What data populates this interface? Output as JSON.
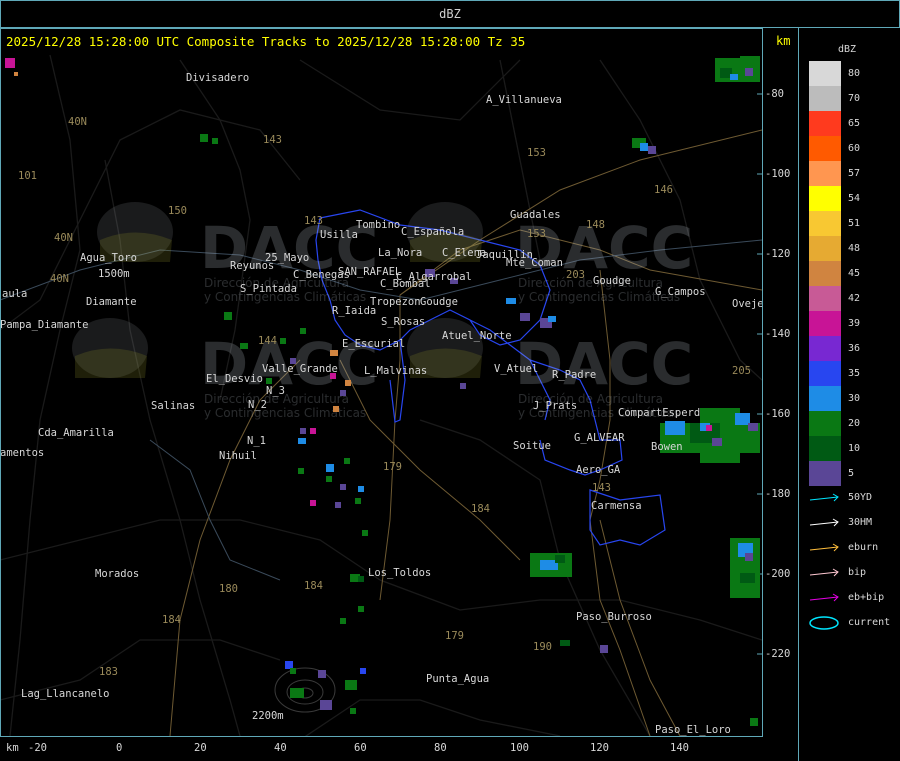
{
  "window": {
    "title": "dBZ"
  },
  "header": {
    "headline": "2025/12/28 15:28:00 UTC Composite Tracks to 2025/12/28 15:28:00 Tz 35",
    "unit_right": "km",
    "unit_bottom_left": "km"
  },
  "axes": {
    "x_ticks": [
      "-20",
      "0",
      "20",
      "40",
      "60",
      "80",
      "100",
      "120",
      "140"
    ],
    "y_ticks": [
      "-80",
      "-100",
      "-120",
      "-140",
      "-160",
      "-180",
      "-200",
      "-220"
    ]
  },
  "legend": {
    "title": "dBZ",
    "levels": [
      {
        "label": "80",
        "color": "#d8d8d8"
      },
      {
        "label": "70",
        "color": "#bcbcbc"
      },
      {
        "label": "65",
        "color": "#ff3a1e"
      },
      {
        "label": "60",
        "color": "#ff5a00"
      },
      {
        "label": "57",
        "color": "#ff9650"
      },
      {
        "label": "54",
        "color": "#ffff00"
      },
      {
        "label": "51",
        "color": "#f8c832"
      },
      {
        "label": "48",
        "color": "#e6aa32"
      },
      {
        "label": "45",
        "color": "#d08440"
      },
      {
        "label": "42",
        "color": "#c85a96"
      },
      {
        "label": "39",
        "color": "#c81496"
      },
      {
        "label": "36",
        "color": "#7828d2"
      },
      {
        "label": "35",
        "color": "#2846f0"
      },
      {
        "label": "30",
        "color": "#1e8ce6"
      },
      {
        "label": "20",
        "color": "#0a7814"
      },
      {
        "label": "10",
        "color": "#005a14"
      },
      {
        "label": "5",
        "color": "#5a4696"
      }
    ],
    "tracks": [
      {
        "label": "50YD",
        "color": "#00e6ff"
      },
      {
        "label": "30HM",
        "color": "#ffffff"
      },
      {
        "label": "eburn",
        "color": "#ffbe3c"
      },
      {
        "label": "bip",
        "color": "#ffc8d2"
      },
      {
        "label": "eb+bip",
        "color": "#e600e6"
      },
      {
        "label": "current",
        "color": "#00e6ff"
      }
    ]
  },
  "watermark": {
    "logo_text": "DACC",
    "subtitle_1": "Dirección de Agricultura",
    "subtitle_2": "y Contingencias Climáticas"
  },
  "places": [
    {
      "name": "Divisadero"
    },
    {
      "name": "A_Villanueva"
    },
    {
      "name": "Guadales"
    },
    {
      "name": "Tombino"
    },
    {
      "name": "Usilla"
    },
    {
      "name": "C_Española"
    },
    {
      "name": "La_Nora"
    },
    {
      "name": "C_Elena"
    },
    {
      "name": "Jaquillin"
    },
    {
      "name": "Mte_Coman"
    },
    {
      "name": "Goudge"
    },
    {
      "name": "G_Campos"
    },
    {
      "name": "Ovejer"
    },
    {
      "name": "Agua_Toro"
    },
    {
      "name": "Reyunos"
    },
    {
      "name": "25_Mayo"
    },
    {
      "name": "C_Benegas"
    },
    {
      "name": "SAN_RAFAEL"
    },
    {
      "name": "C_Algarrobal"
    },
    {
      "name": "C_Bombal"
    },
    {
      "name": "S_Pintada"
    },
    {
      "name": "Tropezon"
    },
    {
      "name": "Goudge"
    },
    {
      "name": "R_Iaida"
    },
    {
      "name": "S_Rosas"
    },
    {
      "name": "Atuel_Norte"
    },
    {
      "name": "aula"
    },
    {
      "name": "Pampa_Diamante"
    },
    {
      "name": "E_Escurial"
    },
    {
      "name": "Valle_Grande"
    },
    {
      "name": "El_Desvio"
    },
    {
      "name": "L_Malvinas"
    },
    {
      "name": "V_Atuel"
    },
    {
      "name": "R_Padre"
    },
    {
      "name": "Salinas"
    },
    {
      "name": "N_3"
    },
    {
      "name": "N_2"
    },
    {
      "name": "J_Prats"
    },
    {
      "name": "CompartEsperd"
    },
    {
      "name": "Cda_Amarilla"
    },
    {
      "name": "N_1"
    },
    {
      "name": "G_ALVEAR"
    },
    {
      "name": "Soitue"
    },
    {
      "name": "Bowen"
    },
    {
      "name": "amentos"
    },
    {
      "name": "Nihuil"
    },
    {
      "name": "Aero_GA"
    },
    {
      "name": "Carmensa"
    },
    {
      "name": "Morados"
    },
    {
      "name": "Los_Toldos"
    },
    {
      "name": "Paso_Burroso"
    },
    {
      "name": "Punta_Agua"
    },
    {
      "name": "Lag_Llancanelo"
    },
    {
      "name": "Paso_El_Loro"
    },
    {
      "name": "2200m"
    },
    {
      "name": "1500m"
    },
    {
      "name": "Diamante"
    }
  ],
  "routes": [
    "143",
    "153",
    "146",
    "148",
    "101",
    "40N",
    "40N",
    "40N",
    "150",
    "143",
    "203",
    "153",
    "144",
    "179",
    "184",
    "180",
    "184",
    "184",
    "183",
    "179",
    "190",
    "143",
    "205"
  ]
}
